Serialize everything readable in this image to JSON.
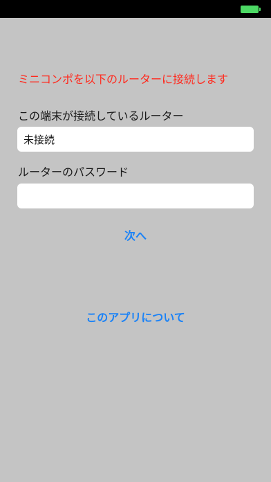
{
  "statusbar": {
    "battery_icon": "battery-full-icon",
    "battery_color": "#4cd964"
  },
  "notice": {
    "text": "ミニコンポを以下のルーターに接続します",
    "color": "#ff2a1e"
  },
  "router": {
    "label": "この端末が接続しているルーター",
    "value": "未接続"
  },
  "password": {
    "label": "ルーターのパスワード",
    "value": ""
  },
  "buttons": {
    "next_label": "次へ",
    "about_label": "このアプリについて",
    "color": "#1a82f7"
  }
}
